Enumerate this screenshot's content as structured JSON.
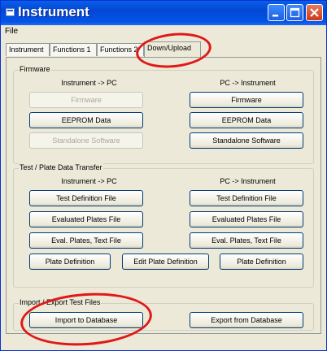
{
  "window": {
    "title": "Instrument"
  },
  "menu": {
    "file": "File"
  },
  "tabs": [
    {
      "label": "Instrument"
    },
    {
      "label": "Functions 1"
    },
    {
      "label": "Functions 2"
    },
    {
      "label": "Down/Upload",
      "active": true
    }
  ],
  "firmware": {
    "legend": "Firmware",
    "left_header": "Instrument -> PC",
    "right_header": "PC -> Instrument",
    "left_buttons": [
      {
        "label": "Firmware",
        "enabled": false
      },
      {
        "label": "EEPROM Data",
        "enabled": true
      },
      {
        "label": "Standalone Software",
        "enabled": false
      }
    ],
    "right_buttons": [
      {
        "label": "Firmware",
        "enabled": true
      },
      {
        "label": "EEPROM Data",
        "enabled": true
      },
      {
        "label": "Standalone Software",
        "enabled": true
      }
    ]
  },
  "transfer": {
    "legend": "Test / Plate Data Transfer",
    "left_header": "Instrument -> PC",
    "right_header": "PC -> Instrument",
    "left_buttons": [
      "Test Definition File",
      "Evaluated Plates File",
      "Eval. Plates, Text File"
    ],
    "right_buttons": [
      "Test Definition File",
      "Evaluated Plates File",
      "Eval. Plates, Text File"
    ],
    "plate_row": [
      "Plate Definition",
      "Edit Plate Definition",
      "Plate Definition"
    ]
  },
  "import_export": {
    "legend": "Import / Export Test Files",
    "import_button": "Import to Database",
    "export_button": "Export from Database"
  },
  "colors": {
    "highlight_circle": "#e01818",
    "titlebar": "#0347d4",
    "face": "#ece9d8"
  }
}
